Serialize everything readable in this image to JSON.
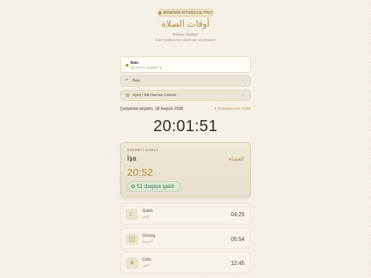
{
  "badge": "MÖMİNİN KİTABÇASI PRO",
  "title_ar": "أوقات الصلاة",
  "subtitle1": "Namaz Vaxtları",
  "subtitle2": "Cari məkanınızı seçməyi unutmayın",
  "location": {
    "name": "Bakı",
    "coords": "40.3747 N, 49.8332° E"
  },
  "selects": {
    "city": {
      "icon": "location-pin-icon",
      "value": "Bakı"
    },
    "schedule": {
      "icon": "calendar-icon",
      "value": "Aylıq / İllik Namaz Cədvəli"
    }
  },
  "date": {
    "gregorian": "Çərşənbə axşamı, 18 Avqust 2026",
    "hijri": "4 Rəbiüləvvəl 1448"
  },
  "clock": "20:01:51",
  "next_prayer": {
    "label": "NÖVBƏTİ NAMAZ",
    "name": "İşa",
    "name_ar": "العشاء",
    "time": "20:52",
    "remaining": "51 dəqiqə qalıb"
  },
  "prayers": [
    {
      "name": "Sübh",
      "name_ar": "الفجر",
      "time": "04:25",
      "icon": "moon-icon"
    },
    {
      "name": "Günəş",
      "name_ar": "الشروق",
      "time": "05:54",
      "icon": "sunrise-icon"
    },
    {
      "name": "Zöhr",
      "name_ar": "الظهر",
      "time": "12:45",
      "icon": "sun-icon"
    }
  ],
  "colors": {
    "accent": "#b08d3c",
    "background": "#f6f1e7",
    "remaining_green": "#3f7a46"
  }
}
